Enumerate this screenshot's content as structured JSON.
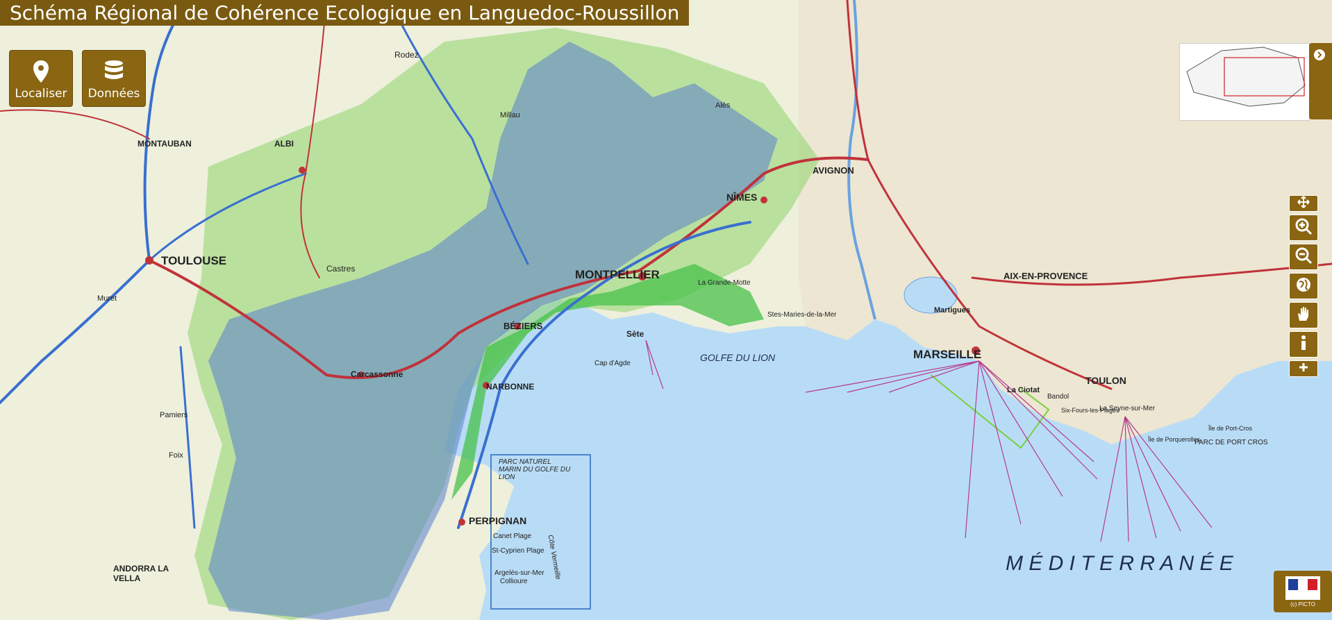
{
  "title": "Schéma Régional de Cohérence Ecologique en Languedoc-Roussillon",
  "toolbar": {
    "localiser_label": "Localiser",
    "donnees_label": "Données"
  },
  "map": {
    "major_labels": [
      "TOULOUSE",
      "MONTPELLIER",
      "MARSEILLE",
      "NÎMES",
      "PERPIGNAN",
      "BÉZIERS",
      "AVIGNON",
      "TOULON",
      "AIX-EN-PROVENCE",
      "NARBONNE",
      "MONTAUBAN",
      "ALBI",
      "Carcassonne",
      "Sète",
      "Rodez",
      "Castres",
      "Muret",
      "Pamiers",
      "Foix",
      "Alès",
      "Millau",
      "Martigues"
    ],
    "sea_labels": [
      "GOLFE  DU  LION",
      "M É D I T E R R A N É E"
    ],
    "other_labels": [
      "ANDORRA LA VELLA",
      "Canet Plage",
      "St-Cyprien Plage",
      "Argelès-sur-Mer",
      "Collioure",
      "Cap d'Agde",
      "La Grande-Motte",
      "Stes-Maries-de-la-Mer",
      "Carcassonne",
      "La Ciotat",
      "Bandol",
      "Six-Fours-les-Plages",
      "La Seyne-sur-Mer",
      "Île de Porquerolles",
      "Île de Port-Cros",
      "PARC DE PORT CROS",
      "Côte Vermeille",
      "PARC NATUREL MARIN DU GOLFE DU LION"
    ],
    "colors": {
      "sea": "#b9dcf6",
      "land": "#eef0dc",
      "corridor_green": "#6ec94a",
      "reservoir_blue": "#4f74c4",
      "road_red": "#c0323a",
      "highway_blue": "#3a6fd0",
      "brand_brown": "#8a6512"
    }
  },
  "zoom_controls": [
    "move-icon",
    "zoom-in-icon",
    "zoom-out-icon",
    "globe-icon",
    "hand-icon",
    "info-icon",
    "plus-icon"
  ],
  "credit": "(c) PICTO"
}
